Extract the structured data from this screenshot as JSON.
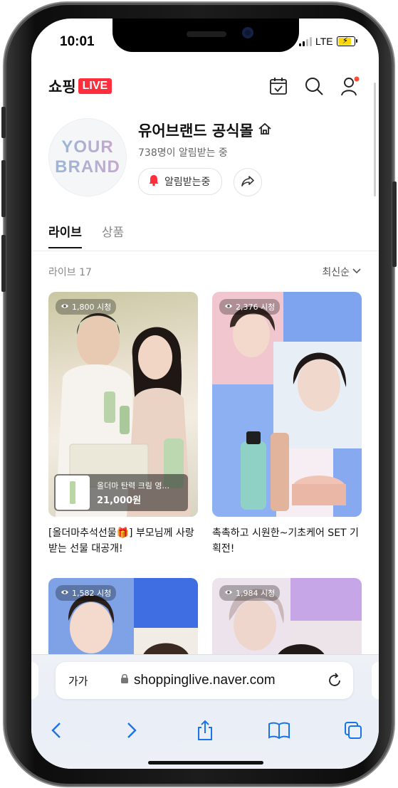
{
  "status": {
    "time": "10:01",
    "network": "LTE"
  },
  "header": {
    "logo_text": "쇼핑",
    "logo_badge": "LIVE"
  },
  "profile": {
    "avatar_line1": "YOUR",
    "avatar_line2": "BRAND",
    "name": "유어브랜드 공식몰",
    "subscribers": "738명이 알림받는 중",
    "alarm_button": "알림받는중"
  },
  "tabs": [
    {
      "label": "라이브",
      "active": true
    },
    {
      "label": "상품",
      "active": false
    }
  ],
  "list": {
    "count_label": "라이브 17",
    "sort_label": "최신순"
  },
  "cards": [
    {
      "views": "1,800 시청",
      "title": "[올더마추석선물🎁] 부모님께 사랑 받는 선물 대공개!",
      "product_name": "올더마 탄력 크림 영...",
      "product_price": "21,000원"
    },
    {
      "views": "2,376 시청",
      "title": "촉촉하고 시원한~기초케어 SET 기획전!"
    },
    {
      "views": "1,582 시청"
    },
    {
      "views": "1,984 시청"
    }
  ],
  "browser": {
    "text_size_label": "가가",
    "url": "shoppinglive.naver.com"
  },
  "icons": {
    "calendar": "calendar-check-icon",
    "search": "search-icon",
    "profile": "user-icon",
    "home": "home-icon",
    "bell": "bell-icon",
    "share": "share-icon",
    "eye": "eye-icon",
    "lock": "lock-icon",
    "reload": "reload-icon",
    "back": "chevron-left-icon",
    "forward": "chevron-right-icon",
    "share_sheet": "share-sheet-icon",
    "bookmarks": "book-icon",
    "tabs": "tabs-icon"
  },
  "colors": {
    "live_red": "#ff2e3d",
    "link_blue": "#1a73e8",
    "notification_dot": "#ff4b33"
  }
}
